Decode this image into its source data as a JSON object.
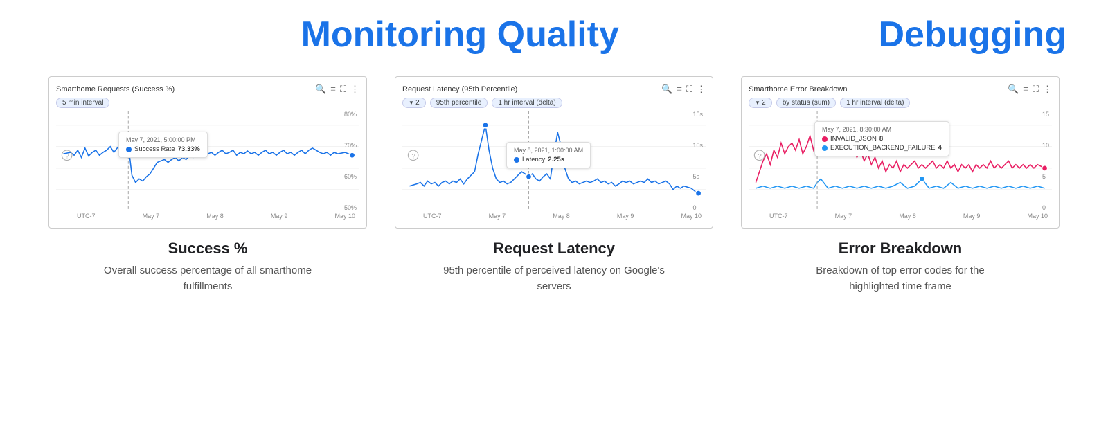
{
  "header": {
    "monitoring_title": "Monitoring Quality",
    "debugging_title": "Debugging"
  },
  "cards": [
    {
      "id": "success",
      "chart_title": "Smarthome Requests (Success %)",
      "filters": [
        "5 min interval"
      ],
      "filter_has_icon": [
        false
      ],
      "y_labels": [
        "80%",
        "70%",
        "60%",
        "50%"
      ],
      "x_labels": [
        "UTC-7",
        "May 7",
        "May 8",
        "May 9",
        "May 10"
      ],
      "tooltip": {
        "date": "May 7, 2021, 5:00:00 PM",
        "metric": "Success Rate",
        "value": "73.33%",
        "color": "#1a73e8"
      },
      "label": "Success %",
      "desc": "Overall success percentage of all smarthome fulfillments",
      "line_color": "#1a73e8",
      "chart_type": "success"
    },
    {
      "id": "latency",
      "chart_title": "Request Latency (95th Percentile)",
      "filters": [
        "2",
        "95th percentile",
        "1 hr interval (delta)"
      ],
      "filter_has_icon": [
        true,
        false,
        false
      ],
      "y_labels": [
        "15s",
        "10s",
        "5s",
        "0"
      ],
      "x_labels": [
        "UTC-7",
        "May 7",
        "May 8",
        "May 9",
        "May 10"
      ],
      "tooltip": {
        "date": "May 8, 2021, 1:00:00 AM",
        "metric": "Latency",
        "value": "2.25s",
        "color": "#1a73e8"
      },
      "label": "Request Latency",
      "desc": "95th percentile of perceived latency on Google's servers",
      "line_color": "#1a73e8",
      "chart_type": "latency"
    },
    {
      "id": "errors",
      "chart_title": "Smarthome Error Breakdown",
      "filters": [
        "2",
        "by status (sum)",
        "1 hr interval (delta)"
      ],
      "filter_has_icon": [
        true,
        false,
        false
      ],
      "y_labels": [
        "15",
        "10",
        "5",
        "0"
      ],
      "x_labels": [
        "UTC-7",
        "May 7",
        "May 8",
        "May 9",
        "May 10"
      ],
      "tooltip": {
        "date": "May 7, 2021, 8:30:00 AM",
        "rows": [
          {
            "metric": "INVALID_JSON",
            "value": "8",
            "color": "#e91e63"
          },
          {
            "metric": "EXECUTION_BACKEND_FAILURE",
            "value": "4",
            "color": "#2196f3"
          }
        ]
      },
      "label": "Error Breakdown",
      "desc": "Breakdown of top error codes for the highlighted time frame",
      "line_color": "#e91e63",
      "line_color2": "#2196f3",
      "chart_type": "errors"
    }
  ]
}
